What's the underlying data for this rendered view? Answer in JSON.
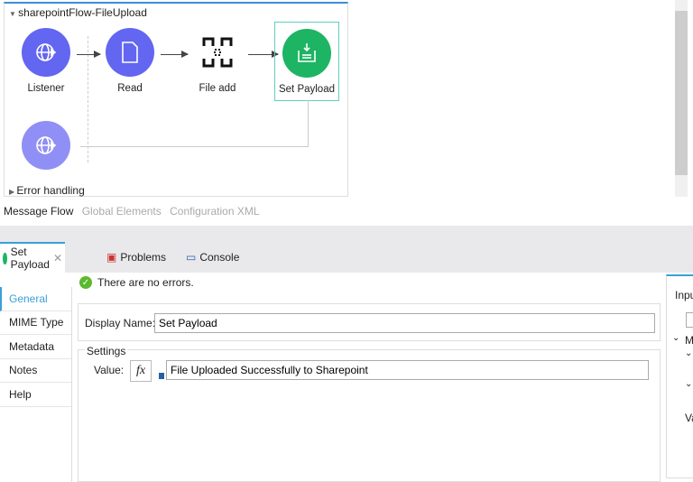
{
  "flow": {
    "title": "sharepointFlow-FileUpload",
    "nodes": [
      {
        "label": "Listener"
      },
      {
        "label": "Read"
      },
      {
        "label": "File add"
      },
      {
        "label": "Set Payload"
      }
    ],
    "error_handling": "Error handling"
  },
  "view_tabs": [
    "Message Flow",
    "Global Elements",
    "Configuration XML"
  ],
  "panel_tabs": [
    {
      "label": "Set Payload"
    },
    {
      "label": "Problems"
    },
    {
      "label": "Console"
    }
  ],
  "status": "There are no errors.",
  "nav": [
    "General",
    "MIME Type",
    "Metadata",
    "Notes",
    "Help"
  ],
  "form": {
    "display_name_label": "Display Name:",
    "display_name": "Set Payload",
    "settings_label": "Settings",
    "value_label": "Value:",
    "fx": "fx",
    "value": "File Uploaded Successfully to Sharepoint"
  },
  "right_panel": {
    "title": "Inpu",
    "m": "M",
    "va": "Va"
  },
  "colors": {
    "node": "#6366f1",
    "payload": "#1db464",
    "accent": "#3aa0d8"
  }
}
